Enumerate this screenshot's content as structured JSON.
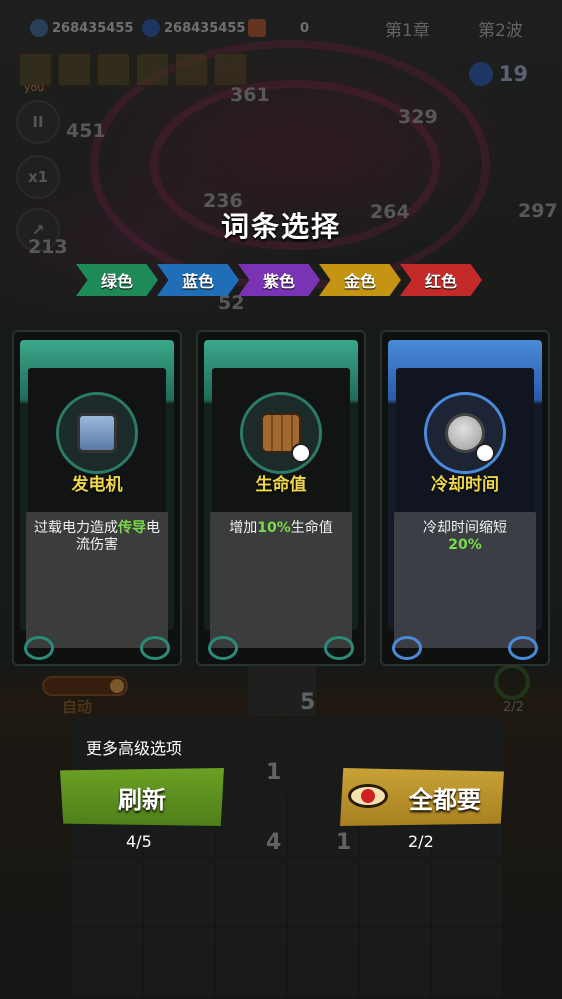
{
  "top_bar": {
    "resource1": "268435455",
    "resource2": "268435455",
    "resource3": "0",
    "chapter": "第1章",
    "wave": "第2波",
    "kills": "19",
    "you_label": "you"
  },
  "side": {
    "pause": "II",
    "speed": "x1"
  },
  "damage_numbers": [
    "361",
    "451",
    "329",
    "236",
    "264",
    "297",
    "213",
    "52"
  ],
  "dialog": {
    "title": "词条选择",
    "tiers": [
      "绿色",
      "蓝色",
      "紫色",
      "金色",
      "红色"
    ],
    "cards": [
      {
        "name": "发电机",
        "icon": "generator-icon",
        "rarity": "green",
        "desc_pre": "过载电力造成",
        "desc_hl": "传导",
        "desc_post": "电流伤害"
      },
      {
        "name": "生命值",
        "icon": "wooden-plank-icon",
        "rarity": "green",
        "desc_pre": "增加",
        "desc_hl": "10%",
        "desc_post": "生命值"
      },
      {
        "name": "冷却时间",
        "icon": "cooldown-gear-icon",
        "rarity": "blue",
        "desc_pre": "冷却时间缩短",
        "desc_hl": "20%",
        "desc_post": ""
      }
    ],
    "more_options": "更多高级选项",
    "refresh_label": "刷新",
    "refresh_count": "4/5",
    "take_all_label": "全都要",
    "take_all_count": "2/2",
    "video_text": "Video"
  },
  "board": {
    "auto_label": "自动",
    "gear_count": "2/2",
    "deck_count": "5",
    "cell_counts": [
      "1",
      "4",
      "1"
    ]
  },
  "colors": {
    "tier_green": "#1e8a58",
    "tier_blue": "#1f6fb8",
    "tier_purple": "#7a33b5",
    "tier_gold": "#c49412",
    "tier_red": "#c42a2a",
    "highlight": "#7bd94a",
    "card_name": "#f0d64a"
  }
}
